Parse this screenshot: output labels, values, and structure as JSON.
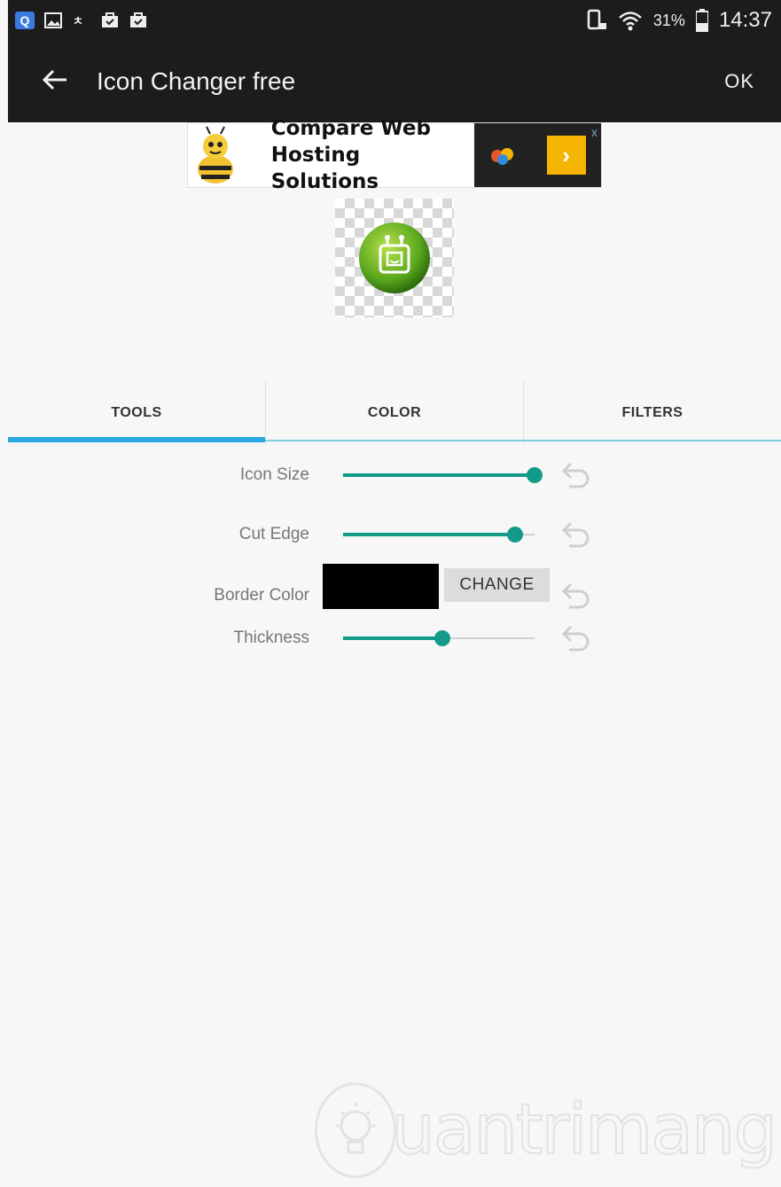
{
  "status_bar": {
    "battery_percent": "31%",
    "time": "14:37",
    "notification_icons": [
      "search-app-icon",
      "image-icon",
      "translate-icon",
      "bag-icon",
      "bag-icon"
    ]
  },
  "app_bar": {
    "title": "Icon Changer free",
    "ok_label": "OK"
  },
  "ad": {
    "line1": "Compare Web",
    "line2": "Hosting Solutions",
    "close_glyph": "x"
  },
  "tabs": [
    {
      "label": "TOOLS",
      "active": true
    },
    {
      "label": "COLOR",
      "active": false
    },
    {
      "label": "FILTERS",
      "active": false
    }
  ],
  "tools": {
    "icon_size": {
      "label": "Icon Size",
      "value": 1.0
    },
    "cut_edge": {
      "label": "Cut Edge",
      "value": 0.9
    },
    "border_color": {
      "label": "Border Color",
      "color": "#000000",
      "change_label": "CHANGE"
    },
    "thickness": {
      "label": "Thickness",
      "value": 0.52
    }
  },
  "colors": {
    "accent": "#139b8a",
    "tab_indicator": "#29a9e0",
    "bar": "#1c1c1c"
  },
  "watermark": {
    "text": "uantrimang"
  }
}
